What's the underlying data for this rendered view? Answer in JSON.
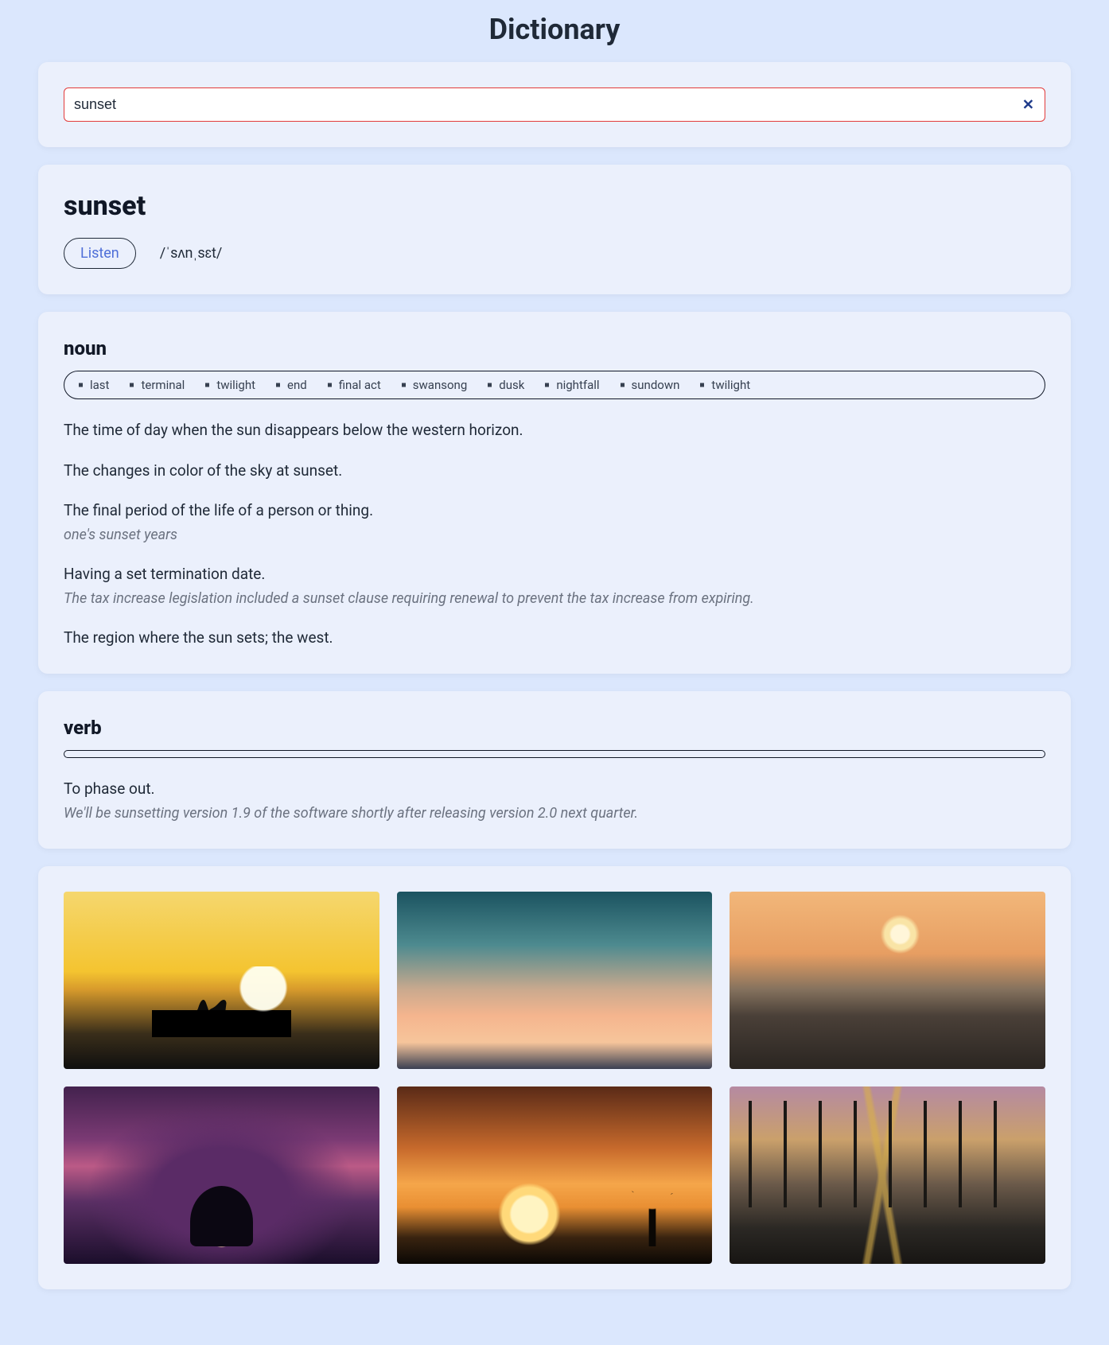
{
  "header": {
    "title": "Dictionary"
  },
  "search": {
    "value": "sunset",
    "placeholder": ""
  },
  "entry": {
    "word": "sunset",
    "listen_label": "Listen",
    "pronunciation": "/ˈsʌnˌsɛt/"
  },
  "parts_of_speech": [
    {
      "label": "noun",
      "synonyms": [
        "last",
        "terminal",
        "twilight",
        "end",
        "final act",
        "swansong",
        "dusk",
        "nightfall",
        "sundown",
        "twilight"
      ],
      "definitions": [
        {
          "text": "The time of day when the sun disappears below the western horizon.",
          "example": ""
        },
        {
          "text": "The changes in color of the sky at sunset.",
          "example": ""
        },
        {
          "text": "The final period of the life of a person or thing.",
          "example": "one's sunset years"
        },
        {
          "text": "Having a set termination date.",
          "example": "The tax increase legislation included a sunset clause requiring renewal to prevent the tax increase from expiring."
        },
        {
          "text": "The region where the sun sets; the west.",
          "example": ""
        }
      ]
    },
    {
      "label": "verb",
      "synonyms": [],
      "definitions": [
        {
          "text": "To phase out.",
          "example": "We'll be sunsetting version 1.9 of the software shortly after releasing version 2.0 next quarter."
        }
      ]
    }
  ],
  "gallery": {
    "count": 6
  }
}
